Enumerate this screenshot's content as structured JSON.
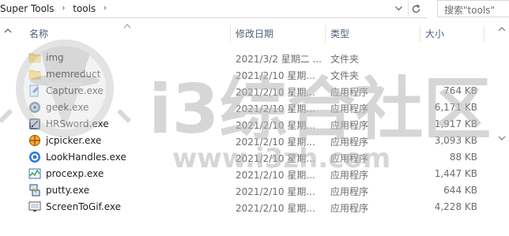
{
  "breadcrumb": [
    "Super Tools",
    "tools"
  ],
  "search": {
    "placeholder": "搜索\"tools\""
  },
  "columns": {
    "name": "名称",
    "date": "修改日期",
    "type": "类型",
    "size": "大小"
  },
  "files": [
    {
      "name": "img",
      "date": "2021/3/2 星期二 ...",
      "type": "文件夹",
      "size": "",
      "icon": "folder-icon"
    },
    {
      "name": "memreduct",
      "date": "2021/2/10 星期...",
      "type": "文件夹",
      "size": "",
      "icon": "folder-icon"
    },
    {
      "name": "Capture.exe",
      "date": "2021/2/10 星期...",
      "type": "应用程序",
      "size": "764 KB",
      "icon": "capture-app-icon"
    },
    {
      "name": "geek.exe",
      "date": "2021/2/10 星期...",
      "type": "应用程序",
      "size": "6,171 KB",
      "icon": "geek-app-icon"
    },
    {
      "name": "HRSword.exe",
      "date": "2021/2/10 星期...",
      "type": "应用程序",
      "size": "1,917 KB",
      "icon": "hrsword-app-icon"
    },
    {
      "name": "jcpicker.exe",
      "date": "2021/2/10 星期...",
      "type": "应用程序",
      "size": "3,093 KB",
      "icon": "color-picker-app-icon"
    },
    {
      "name": "LookHandles.exe",
      "date": "2021/2/10 星期...",
      "type": "应用程序",
      "size": "88 KB",
      "icon": "lookhandles-app-icon"
    },
    {
      "name": "procexp.exe",
      "date": "2021/2/10 星期...",
      "type": "应用程序",
      "size": "1,447 KB",
      "icon": "procexp-app-icon"
    },
    {
      "name": "putty.exe",
      "date": "2021/2/10 星期...",
      "type": "应用程序",
      "size": "644 KB",
      "icon": "putty-app-icon"
    },
    {
      "name": "ScreenToGif.exe",
      "date": "2021/2/10 星期...",
      "type": "应用程序",
      "size": "4,228 KB",
      "icon": "screentogif-app-icon"
    }
  ],
  "watermark": {
    "main": "i3综合社区",
    "sub": "www.i3zh.com"
  },
  "colors": {
    "header_text": "#4c607a",
    "folder": "#f2c94c",
    "muted": "#6d6d6d"
  }
}
